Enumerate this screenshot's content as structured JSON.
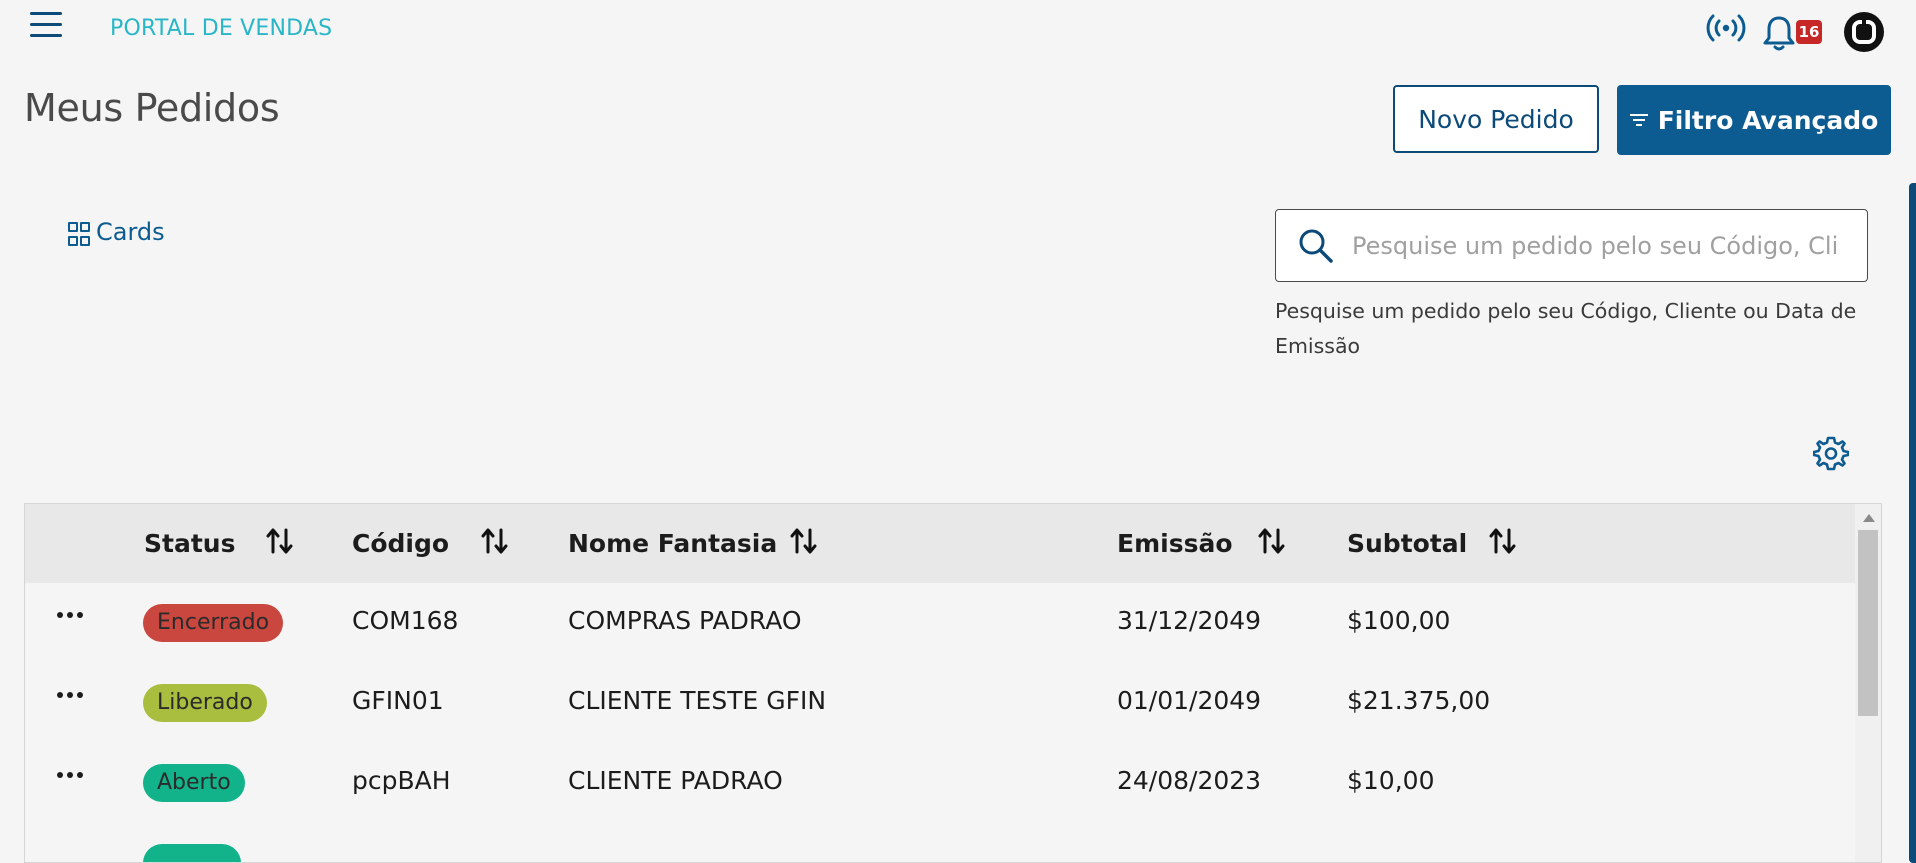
{
  "header": {
    "app_title": "PORTAL DE VENDAS",
    "notification_count": "16"
  },
  "page": {
    "title": "Meus Pedidos",
    "new_order_label": "Novo Pedido",
    "advanced_filter_label": "Filtro Avançado",
    "view_toggle_label": "Cards"
  },
  "search": {
    "placeholder": "Pesquise um pedido pelo seu Código, Cliente ou Data de Emissão",
    "help": "Pesquise um pedido pelo seu Código, Cliente ou Data de Emissão"
  },
  "table": {
    "columns": [
      "Status",
      "Código",
      "Nome Fantasia",
      "Emissão",
      "Subtotal"
    ],
    "rows": [
      {
        "status": "Encerrado",
        "status_color": "#c9473f",
        "codigo": "COM168",
        "nome": "COMPRAS PADRAO",
        "emissao": "31/12/2049",
        "subtotal": "$100,00"
      },
      {
        "status": "Liberado",
        "status_color": "#a9bd3e",
        "codigo": "GFIN01",
        "nome": "CLIENTE TESTE GFIN",
        "emissao": "01/01/2049",
        "subtotal": "$21.375,00"
      },
      {
        "status": "Aberto",
        "status_color": "#12b28a",
        "codigo": "pcpBAH",
        "nome": "CLIENTE PADRAO",
        "emissao": "24/08/2023",
        "subtotal": "$10,00"
      },
      {
        "status": "",
        "status_color": "#12b28a",
        "codigo": "",
        "nome": "",
        "emissao": "",
        "subtotal": ""
      }
    ]
  },
  "colors": {
    "primary": "#0c5b91",
    "dark_primary": "#0c4a7a",
    "accent_title": "#29b6c6",
    "badge_red": "#c62828"
  }
}
